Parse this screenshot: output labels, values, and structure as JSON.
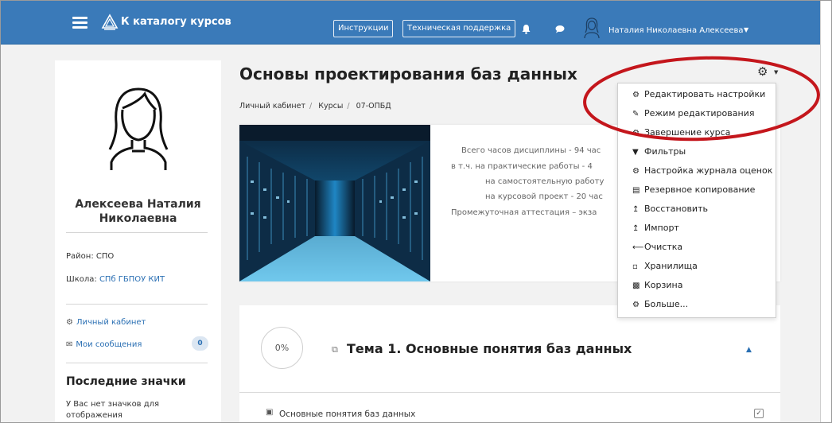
{
  "navbar": {
    "brand": "К каталогу курсов",
    "btn_instructions": "Инструкции",
    "btn_support": "Техническая поддержка",
    "user_name": "Наталия Николаевна Алексеева"
  },
  "sidebar": {
    "profile_name": "Алексеева Наталия Николаевна",
    "region_label": "Район:",
    "region_value": "СПО",
    "school_label": "Школа:",
    "school_value": "СПб ГБПОУ КИТ",
    "link_dashboard": "Личный кабинет",
    "link_messages": "Мои сообщения",
    "messages_count": "0",
    "badges_heading": "Последние значки",
    "no_badges": "У Вас нет значков для отображения"
  },
  "course": {
    "title": "Основы проектирования баз данных",
    "breadcrumb": [
      "Личный кабинет",
      "Курсы",
      "07-ОПБД"
    ],
    "desc_lines": [
      "Всего часов  дисциплины - 94 час",
      "в т.ч. на  практические работы - 4",
      "на  самостоятельную работу",
      "на курсовой проект  - 20 час",
      "Промежуточная аттестация – экза"
    ]
  },
  "topic": {
    "progress": "0%",
    "title": "Тема 1. Основные понятия баз данных",
    "item_label": "Основные понятия баз данных"
  },
  "menu": {
    "items": [
      {
        "label": "Редактировать настройки",
        "icon": "cog-icon"
      },
      {
        "label": "Режим редактирования",
        "icon": "pencil-icon"
      },
      {
        "label": "Завершение курса",
        "icon": "cog-icon"
      },
      {
        "label": "Фильтры",
        "icon": "filter-icon"
      },
      {
        "label": "Настройка журнала оценок",
        "icon": "cog-icon"
      },
      {
        "label": "Резервное копирование",
        "icon": "backup-icon"
      },
      {
        "label": "Восстановить",
        "icon": "upload-icon"
      },
      {
        "label": "Импорт",
        "icon": "upload-icon"
      },
      {
        "label": "Очистка",
        "icon": "arrow-left-icon"
      },
      {
        "label": "Хранилища",
        "icon": "storage-icon"
      },
      {
        "label": "Корзина",
        "icon": "trash-icon"
      },
      {
        "label": "Больше...",
        "icon": "cog-icon"
      }
    ]
  },
  "colors": {
    "navbar": "#3a7ab9",
    "link": "#2a6fb3",
    "annotation": "#c4161c"
  }
}
